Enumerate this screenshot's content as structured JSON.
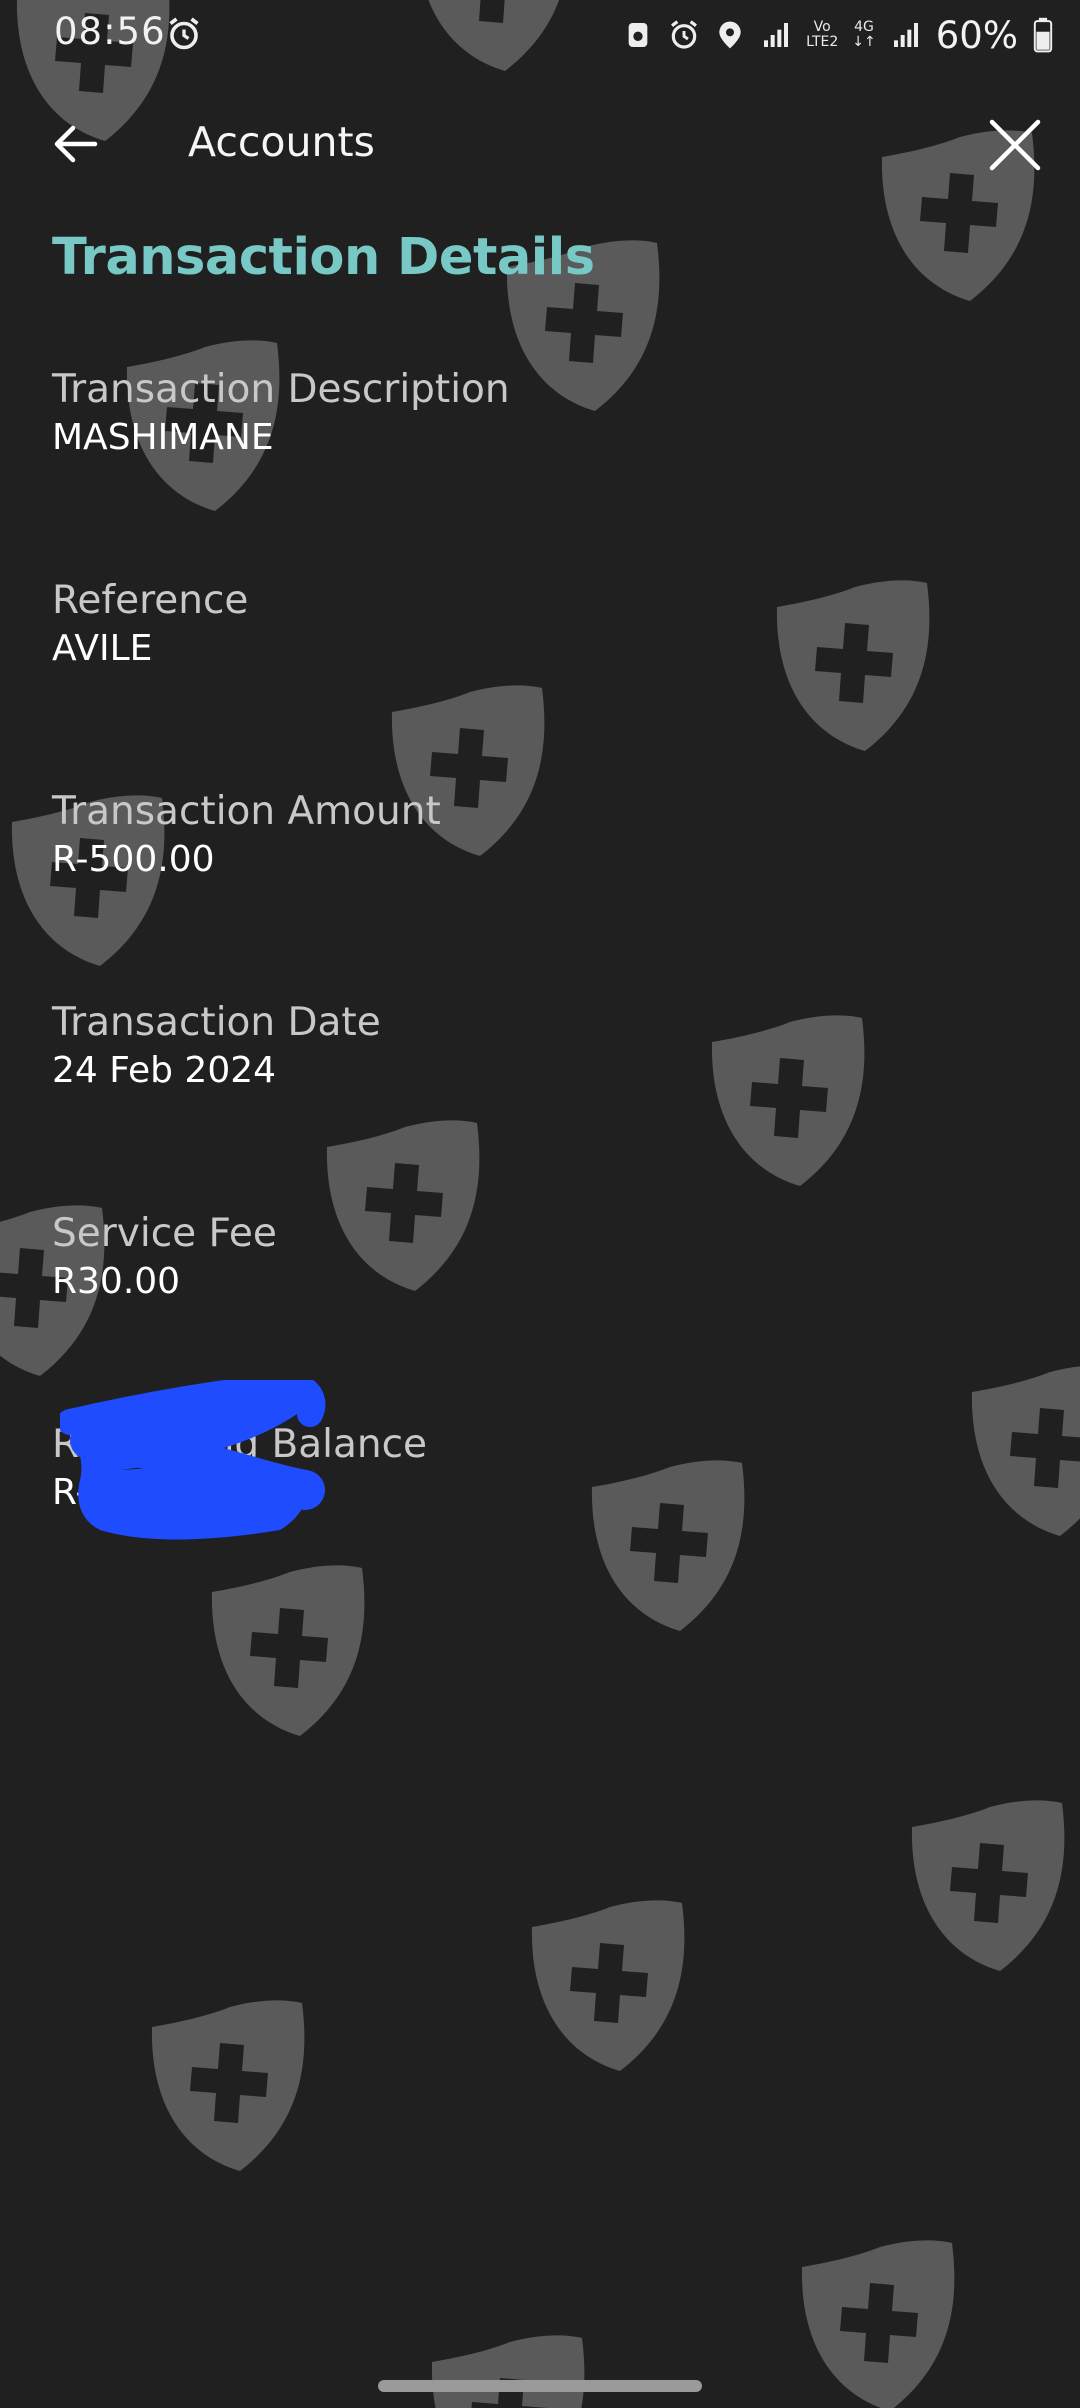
{
  "status_bar": {
    "time": "08:56",
    "battery": "60%",
    "network_label_top": "Vo",
    "network_label_bottom": "LTE2",
    "network_gen": "4G",
    "icons": [
      "alarm-icon",
      "screen-recorder-icon",
      "alarm-icon",
      "location-icon",
      "signal-icon",
      "signal-icon",
      "battery-icon"
    ]
  },
  "app_bar": {
    "title": "Accounts",
    "back_icon": "arrow-left-icon",
    "close_icon": "close-icon"
  },
  "section_title": "Transaction Details",
  "fields": [
    {
      "label": "Transaction Description",
      "value": "MASHIMANE"
    },
    {
      "label": "Reference",
      "value": "AVILE"
    },
    {
      "label": "Transaction Amount",
      "value": "R-500.00"
    },
    {
      "label": "Transaction Date",
      "value": "24 Feb 2024"
    },
    {
      "label": "Service Fee",
      "value": "R30.00"
    },
    {
      "label": "Remaining Balance",
      "value": "R-",
      "redacted": true
    }
  ],
  "background_pattern": "shield-plus-icon",
  "colors": {
    "background": "#202020",
    "accent": "#78c9c6",
    "pattern": "#5a5a5a",
    "redaction": "#1f4cff"
  }
}
